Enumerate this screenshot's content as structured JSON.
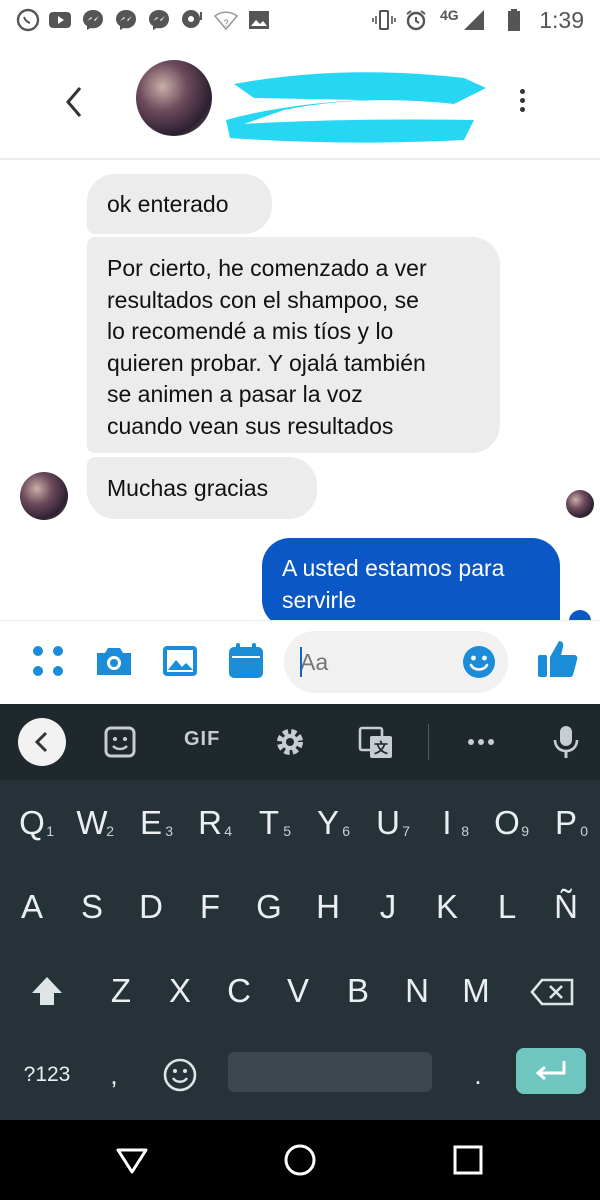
{
  "status_bar": {
    "time": "1:39",
    "network": "4G",
    "icons": [
      "whatsapp-icon",
      "youtube-icon",
      "messenger-icon",
      "messenger-icon",
      "messenger-icon",
      "chat-icon",
      "wifi-icon",
      "image-icon",
      "vibrate-icon",
      "alarm-icon",
      "signal-icon",
      "battery-icon"
    ]
  },
  "header": {
    "back_icon": "back-arrow-icon",
    "menu_icon": "kebab-menu-icon"
  },
  "messages": [
    {
      "side": "incoming",
      "text": "ok  enterado"
    },
    {
      "side": "incoming",
      "lines": [
        "Por cierto, he comenzado a ver",
        "resultados con el shampoo, se",
        "lo recomendé a mis tíos y lo",
        "quieren probar. Y ojalá también",
        "se animen a pasar la voz",
        "cuando vean sus resultados"
      ]
    },
    {
      "side": "incoming",
      "text": "Muchas gracias"
    },
    {
      "side": "outgoing",
      "lines": [
        "A usted estamos para",
        "servirle"
      ]
    }
  ],
  "composer": {
    "placeholder": "Aa",
    "icons": [
      "apps-grid-icon",
      "camera-icon",
      "gallery-icon",
      "calendar-icon",
      "emoji-icon",
      "thumbs-up-icon"
    ]
  },
  "keyboard": {
    "toolbar": {
      "gif_label": "GIF"
    },
    "row1": [
      {
        "k": "Q",
        "h": "1"
      },
      {
        "k": "W",
        "h": "2"
      },
      {
        "k": "E",
        "h": "3"
      },
      {
        "k": "R",
        "h": "4"
      },
      {
        "k": "T",
        "h": "5"
      },
      {
        "k": "Y",
        "h": "6"
      },
      {
        "k": "U",
        "h": "7"
      },
      {
        "k": "I",
        "h": "8"
      },
      {
        "k": "O",
        "h": "9"
      },
      {
        "k": "P",
        "h": "0"
      }
    ],
    "row2": [
      "A",
      "S",
      "D",
      "F",
      "G",
      "H",
      "J",
      "K",
      "L",
      "Ñ"
    ],
    "row3": [
      "Z",
      "X",
      "C",
      "V",
      "B",
      "N",
      "M"
    ],
    "symbols_label": "?123",
    "comma_label": ",",
    "period_label": "."
  },
  "colors": {
    "outgoing_bubble": "#0b57c6",
    "incoming_bubble": "#ececec",
    "messenger_blue": "#1a8cd8",
    "keyboard_bg": "#263238",
    "enter_key": "#6fc6c1"
  }
}
